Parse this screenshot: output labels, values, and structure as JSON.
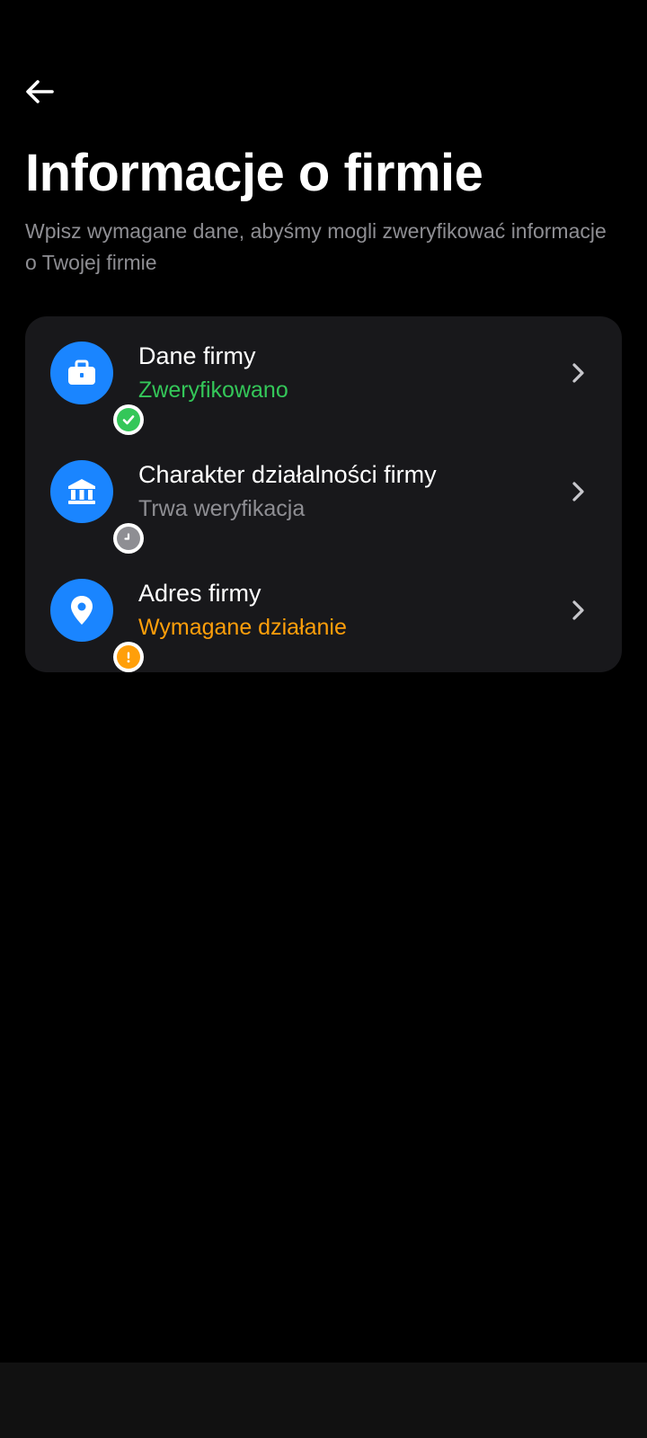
{
  "header": {
    "back_icon": "arrow-left-icon",
    "title": "Informacje o firmie",
    "subtitle": "Wpisz wymagane dane, abyśmy mogli zweryfikować informacje o Twojej firmie"
  },
  "sections": [
    {
      "title": "Dane firmy",
      "status": "Zweryfikowano",
      "status_color": "#34c759",
      "icon": "briefcase-icon",
      "badge": "check-badge-icon"
    },
    {
      "title": "Charakter działalności firmy",
      "status": "Trwa weryfikacja",
      "status_color": "#8e8e93",
      "icon": "bank-icon",
      "badge": "clock-badge-icon"
    },
    {
      "title": "Adres firmy",
      "status": "Wymagane działanie",
      "status_color": "#ff9f0a",
      "icon": "location-pin-icon",
      "badge": "warning-badge-icon"
    }
  ],
  "colors": {
    "accent": "#1a85ff",
    "card_background": "#18181b",
    "background": "#000000"
  }
}
